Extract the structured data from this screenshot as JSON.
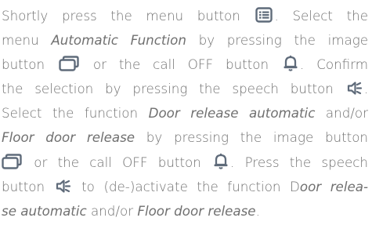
{
  "instructions": {
    "l1_a": "Shortly press the menu button ",
    "l1_b": ". Select the",
    "l2_a": "menu ",
    "l2_em": "Automatic Function",
    "l2_b": " by pressing the image",
    "l3_a": "button ",
    "l3_b": " or the call OFF button ",
    "l3_c": ". Confirm",
    "l4_a": "the selection by pressing the speech button ",
    "l4_b": ".",
    "l5_a": "Select the function ",
    "l5_em": "Door release automatic",
    "l5_b": " and/or",
    "l6_em": "Floor door release",
    "l6_b": " by pressing the image button",
    "l7_b": " or the call OFF button ",
    "l7_c": ". Press the speech",
    "l8_a": "button ",
    "l8_b": " to (de-)activate the function D",
    "l8_em": "oor relea-",
    "l9_em": "se automatic",
    "l9_b": " and/or ",
    "l9_em2": "Floor door release",
    "l9_c": "."
  },
  "icons": {
    "menu": "menu-button-icon",
    "image": "image-button-icon",
    "bell": "call-off-bell-icon",
    "speech": "speech-button-icon",
    "color": "#5f6b7a"
  }
}
